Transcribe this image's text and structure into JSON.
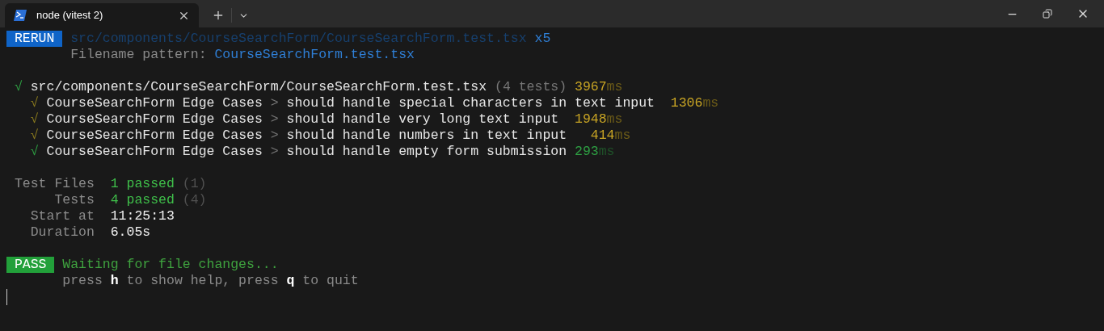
{
  "tab": {
    "title": "node (vitest 2)",
    "selected": true
  },
  "rerun": {
    "badge": "RERUN",
    "path": "src/components/CourseSearchForm/CourseSearchForm.test.tsx",
    "count": "x5",
    "pattern_label": "Filename pattern:",
    "pattern": "CourseSearchForm.test.tsx"
  },
  "file_result": {
    "check": "√",
    "path": "src/components/CourseSearchForm/CourseSearchForm.test.tsx",
    "tests": "(4 tests)",
    "duration": "3967",
    "unit": "ms",
    "kind": "slow"
  },
  "tests": [
    {
      "check": "√",
      "suite": "CourseSearchForm Edge Cases",
      "sep": ">",
      "name": "should handle special characters in text input",
      "duration": "1306",
      "unit": "ms",
      "kind": "slow"
    },
    {
      "check": "√",
      "suite": "CourseSearchForm Edge Cases",
      "sep": ">",
      "name": "should handle very long text input",
      "duration": "1948",
      "unit": "ms",
      "kind": "slow"
    },
    {
      "check": "√",
      "suite": "CourseSearchForm Edge Cases",
      "sep": ">",
      "name": "should handle numbers in text input",
      "duration": "414",
      "unit": "ms",
      "kind": "slow"
    },
    {
      "check": "√",
      "suite": "CourseSearchForm Edge Cases",
      "sep": ">",
      "name": "should handle empty form submission",
      "duration": "293",
      "unit": "ms",
      "kind": "fast"
    }
  ],
  "summary": [
    {
      "label": "Test Files",
      "value": "1 passed",
      "extra": "(1)",
      "kind": "passed"
    },
    {
      "label": "Tests",
      "value": "4 passed",
      "extra": "(4)",
      "kind": "passed"
    },
    {
      "label": "Start at",
      "value": "11:25:13",
      "kind": "plain"
    },
    {
      "label": "Duration",
      "value": "6.05s",
      "kind": "plain"
    }
  ],
  "pass": {
    "badge": "PASS",
    "message": "Waiting for file changes...",
    "hint": [
      {
        "text": "press",
        "key": false
      },
      {
        "text": "h",
        "key": true
      },
      {
        "text": "to show help, press",
        "key": false
      },
      {
        "text": "q",
        "key": true
      },
      {
        "text": "to quit",
        "key": false
      }
    ]
  }
}
